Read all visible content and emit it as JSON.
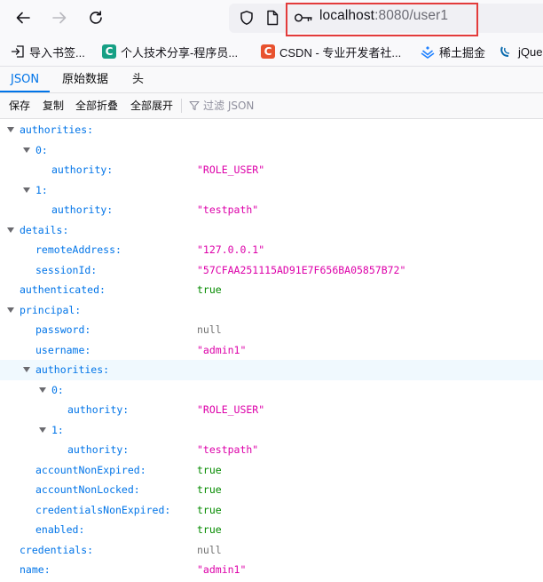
{
  "browser": {
    "url_host": "localhost",
    "url_rest": ":8080/user1",
    "highlight_color": "#e33b3b"
  },
  "bookmarks": [
    {
      "label": "导入书签...",
      "icon": "import-icon"
    },
    {
      "label": "个人技术分享-程序员...",
      "icon": "c-favicon-teal",
      "badge": "C",
      "color": "#16a085"
    },
    {
      "label": "CSDN - 专业开发者社...",
      "icon": "c-favicon-red",
      "badge": "C",
      "color": "#e8522f"
    },
    {
      "label": "稀土掘金",
      "icon": "juejin-icon"
    },
    {
      "label": "jQue",
      "icon": "jquery-icon"
    }
  ],
  "tabs": [
    {
      "label": "JSON",
      "active": true
    },
    {
      "label": "原始数据",
      "active": false
    },
    {
      "label": "头",
      "active": false
    }
  ],
  "toolbar": {
    "save": "保存",
    "copy": "复制",
    "collapse_all": "全部折叠",
    "expand_all": "全部展开",
    "filter_placeholder": "过滤 JSON"
  },
  "rows": [
    {
      "key": "authorities:",
      "depth": 0,
      "toggle": true
    },
    {
      "key": "0:",
      "depth": 1,
      "toggle": true
    },
    {
      "key": "authority:",
      "depth": 2,
      "value": "\"ROLE_USER\"",
      "vtype": "str"
    },
    {
      "key": "1:",
      "depth": 1,
      "toggle": true
    },
    {
      "key": "authority:",
      "depth": 2,
      "value": "\"testpath\"",
      "vtype": "str"
    },
    {
      "key": "details:",
      "depth": 0,
      "toggle": true
    },
    {
      "key": "remoteAddress:",
      "depth": 1,
      "value": "\"127.0.0.1\"",
      "vtype": "str"
    },
    {
      "key": "sessionId:",
      "depth": 1,
      "value": "\"57CFAA251115AD91E7F656BA05857B72\"",
      "vtype": "str"
    },
    {
      "key": "authenticated:",
      "depth": 0,
      "value": "true",
      "vtype": "bool"
    },
    {
      "key": "principal:",
      "depth": 0,
      "toggle": true
    },
    {
      "key": "password:",
      "depth": 1,
      "value": "null",
      "vtype": "null"
    },
    {
      "key": "username:",
      "depth": 1,
      "value": "\"admin1\"",
      "vtype": "str"
    },
    {
      "key": "authorities:",
      "depth": 1,
      "toggle": true,
      "highlight": true
    },
    {
      "key": "0:",
      "depth": 2,
      "toggle": true
    },
    {
      "key": "authority:",
      "depth": 3,
      "value": "\"ROLE_USER\"",
      "vtype": "str"
    },
    {
      "key": "1:",
      "depth": 2,
      "toggle": true
    },
    {
      "key": "authority:",
      "depth": 3,
      "value": "\"testpath\"",
      "vtype": "str"
    },
    {
      "key": "accountNonExpired:",
      "depth": 1,
      "value": "true",
      "vtype": "bool"
    },
    {
      "key": "accountNonLocked:",
      "depth": 1,
      "value": "true",
      "vtype": "bool"
    },
    {
      "key": "credentialsNonExpired:",
      "depth": 1,
      "value": "true",
      "vtype": "bool"
    },
    {
      "key": "enabled:",
      "depth": 1,
      "value": "true",
      "vtype": "bool"
    },
    {
      "key": "credentials:",
      "depth": 0,
      "value": "null",
      "vtype": "null"
    },
    {
      "key": "name:",
      "depth": 0,
      "value": "\"admin1\"",
      "vtype": "str"
    }
  ]
}
